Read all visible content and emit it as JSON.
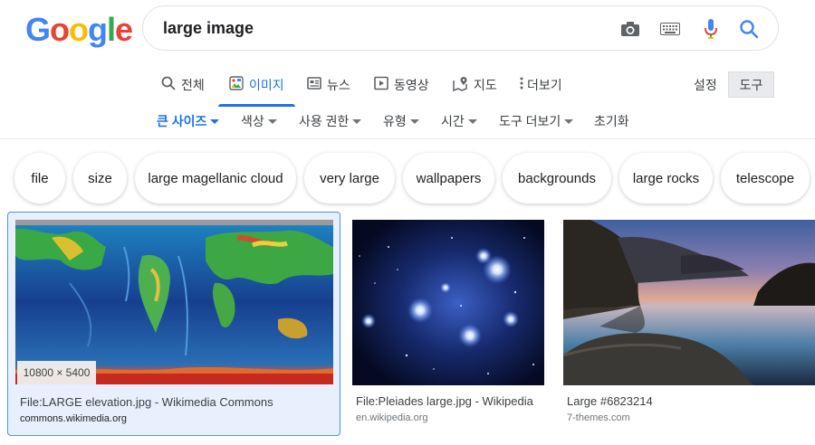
{
  "logo": {
    "letters": [
      "G",
      "o",
      "o",
      "g",
      "l",
      "e"
    ],
    "colors": [
      "#4285f4",
      "#ea4335",
      "#fbbc05",
      "#4285f4",
      "#34a853",
      "#ea4335"
    ]
  },
  "search": {
    "query": "large image",
    "icons": [
      "camera-icon",
      "keyboard-icon",
      "mic-icon",
      "search-icon"
    ]
  },
  "tabs": [
    {
      "label": "전체",
      "icon": "search-icon"
    },
    {
      "label": "이미지",
      "icon": "image-icon",
      "active": true
    },
    {
      "label": "뉴스",
      "icon": "news-icon"
    },
    {
      "label": "동영상",
      "icon": "video-icon"
    },
    {
      "label": "지도",
      "icon": "map-pin-icon"
    },
    {
      "label": "더보기",
      "icon": "more-vert-icon"
    }
  ],
  "settings_label": "설정",
  "tools_label": "도구",
  "filters": [
    {
      "label": "큰 사이즈",
      "active": true
    },
    {
      "label": "색상"
    },
    {
      "label": "사용 권한"
    },
    {
      "label": "유형"
    },
    {
      "label": "시간"
    },
    {
      "label": "도구 더보기"
    },
    {
      "label": "초기화"
    }
  ],
  "chips": [
    "file",
    "size",
    "large magellanic cloud",
    "very large",
    "wallpapers",
    "backgrounds",
    "large rocks",
    "telescope"
  ],
  "results": [
    {
      "title": "File:LARGE elevation.jpg - Wikimedia Commons",
      "source": "commons.wikimedia.org",
      "dims": "10800 × 5400",
      "image": "world-elevation-map"
    },
    {
      "title": "File:Pleiades large.jpg - Wikipedia",
      "source": "en.wikipedia.org",
      "image": "pleiades-star-cluster"
    },
    {
      "title": "Large #6823214",
      "source": "7-themes.com",
      "image": "coastal-rocks-sunset"
    }
  ],
  "colors": {
    "accent": "#1a73e8",
    "selected_bg": "#e8f0fe"
  }
}
